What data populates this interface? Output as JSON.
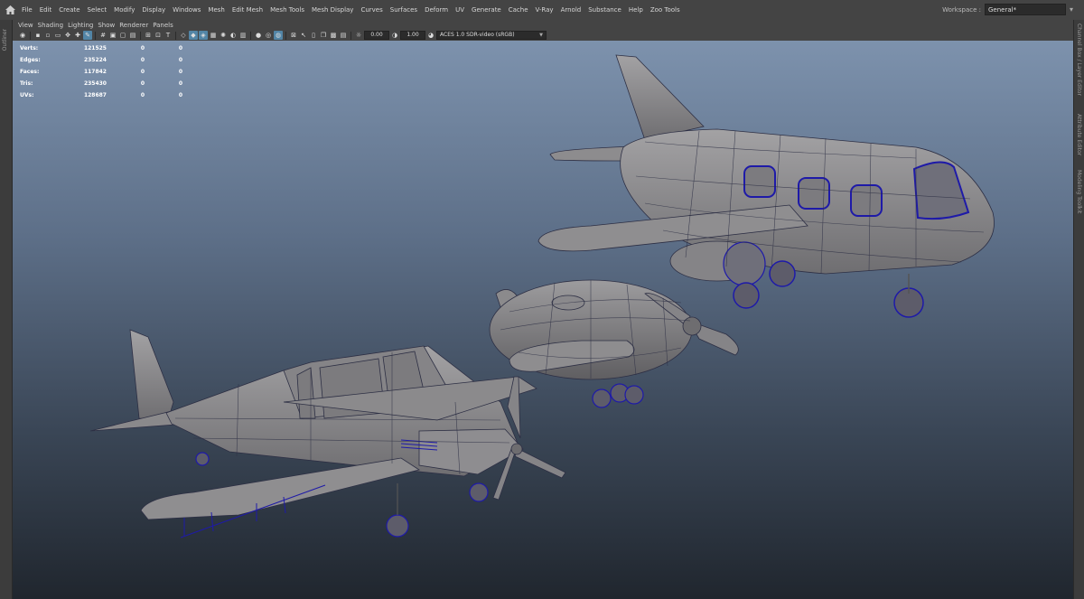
{
  "menubar": {
    "items": [
      "File",
      "Edit",
      "Create",
      "Select",
      "Modify",
      "Display",
      "Windows",
      "Mesh",
      "Edit Mesh",
      "Mesh Tools",
      "Mesh Display",
      "Curves",
      "Surfaces",
      "Deform",
      "UV",
      "Generate",
      "Cache",
      "V-Ray",
      "Arnold",
      "Substance",
      "Help",
      "Zoo Tools"
    ],
    "workspace_label": "Workspace :",
    "workspace_value": "General*"
  },
  "left_strip": {
    "label": "Outliner"
  },
  "right_strip": {
    "labels": [
      "Channel Box / Layer Editor",
      "Attribute Editor",
      "Modeling Toolkit"
    ]
  },
  "panel_menu": {
    "items": [
      "View",
      "Shading",
      "Lighting",
      "Show",
      "Renderer",
      "Panels"
    ]
  },
  "panel_toolbar": {
    "exposure": "0.00",
    "gamma": "1.00",
    "color_space": "ACES 1.0 SDR-video (sRGB)"
  },
  "hud": {
    "rows": [
      {
        "label": "Verts:",
        "value": "121525",
        "sel": "0",
        "comp": "0"
      },
      {
        "label": "Edges:",
        "value": "235224",
        "sel": "0",
        "comp": "0"
      },
      {
        "label": "Faces:",
        "value": "117842",
        "sel": "0",
        "comp": "0"
      },
      {
        "label": "Tris:",
        "value": "235430",
        "sel": "0",
        "comp": "0"
      },
      {
        "label": "UVs:",
        "value": "128687",
        "sel": "0",
        "comp": "0"
      }
    ]
  },
  "colors": {
    "ui_bg": "#444444",
    "highlight": "#5285a6",
    "mesh_fill": "#8e8d8e",
    "wire": "#2d2f44",
    "selection_wire": "#1e1aa8"
  }
}
